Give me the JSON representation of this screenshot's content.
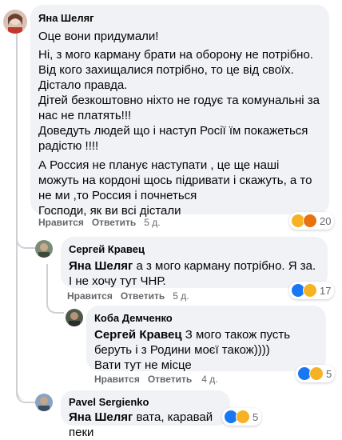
{
  "comments": [
    {
      "author": "Яна Шеляг",
      "lines": [
        "Оце вони придумали!",
        "Ні, з мого карману брати на оборону не потрібно. Від кого захищалися потрібно, то це від своїх.",
        "Дістало правда.",
        "Дітей безкоштовно ніхто не годує та комунальні за нас не платять!!!",
        "Доведуть людей що і наступ Росії їм покажеться радістю !!!!",
        "А Россия не планує наступати , це ще наші можуть на кордоні щось підривати і скажуть, а то не ми ,то Россия і почнеться",
        "Господи, як ви всі дістали"
      ],
      "actions": {
        "like": "Нравится",
        "reply": "Ответить",
        "time": "5 д."
      },
      "reactions": {
        "icons": [
          "haha-icon",
          "angry-icon"
        ],
        "count": "20"
      }
    },
    {
      "author": "Сергей Кравец",
      "mention": "Яна Шеляг",
      "text": " а з мого карману потрібно. Я за. І не хочу тут ЧНР.",
      "actions": {
        "like": "Нравится",
        "reply": "Ответить",
        "time": "5 д."
      },
      "reactions": {
        "icons": [
          "like-icon",
          "haha-icon"
        ],
        "count": "17"
      }
    },
    {
      "author": "Коба Демченко",
      "mention": "Сергей Кравец",
      "text": " З мого також пусть беруть і з Родини моєї також))))",
      "text2": "Вати тут не місце",
      "actions": {
        "like": "Нравится",
        "reply": "Ответить",
        "time": "4 д."
      },
      "reactions": {
        "icons": [
          "like-icon",
          "haha-icon"
        ],
        "count": "5"
      }
    },
    {
      "author": "Pavel Sergienko",
      "mention": "Яна Шеляг",
      "text": " вата, каравай пеки",
      "reactions": {
        "icons": [
          "like-icon",
          "haha-icon"
        ],
        "count": "5"
      }
    }
  ],
  "colors": {
    "bubble": "#f0f2f5",
    "meta": "#65676b",
    "like": "#1877f2",
    "haha": "#f7b125",
    "angry": "#e9710f"
  }
}
